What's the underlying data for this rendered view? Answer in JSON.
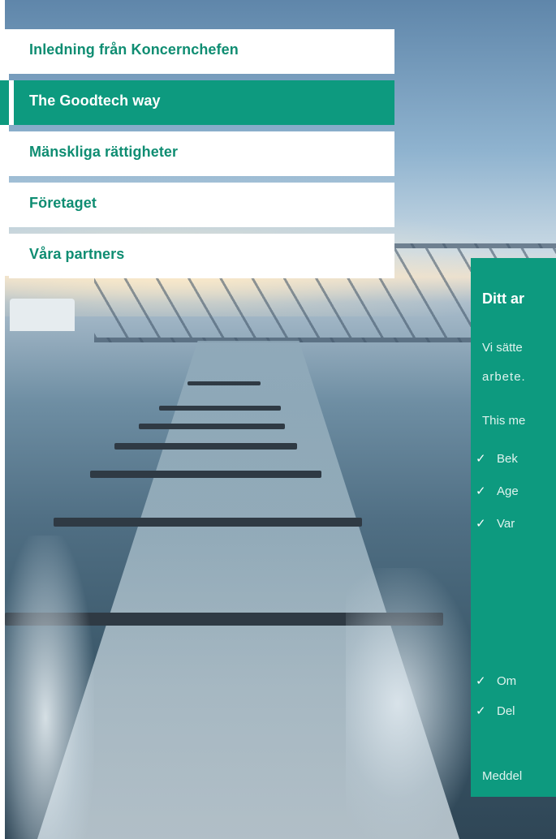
{
  "nav": {
    "items": [
      {
        "label": "Inledning från Koncernchefen",
        "active": false
      },
      {
        "label": "The Goodtech way",
        "active": true
      },
      {
        "label": "Mänskliga rättigheter",
        "active": false
      },
      {
        "label": "Företaget",
        "active": false
      },
      {
        "label": "Våra partners",
        "active": false
      }
    ]
  },
  "panel": {
    "title": "Ditt ar",
    "para1": "Vi sätte",
    "para2": "arbete.",
    "para3": "This me",
    "checklist": [
      "Bek",
      "Age",
      "Var",
      "Om",
      "Del"
    ],
    "footer": "Meddel",
    "check_glyph": "✓"
  },
  "colors": {
    "accent": "#0d9a7f",
    "accent_text": "#0f8d72",
    "nav_bg": "#ffffff"
  }
}
